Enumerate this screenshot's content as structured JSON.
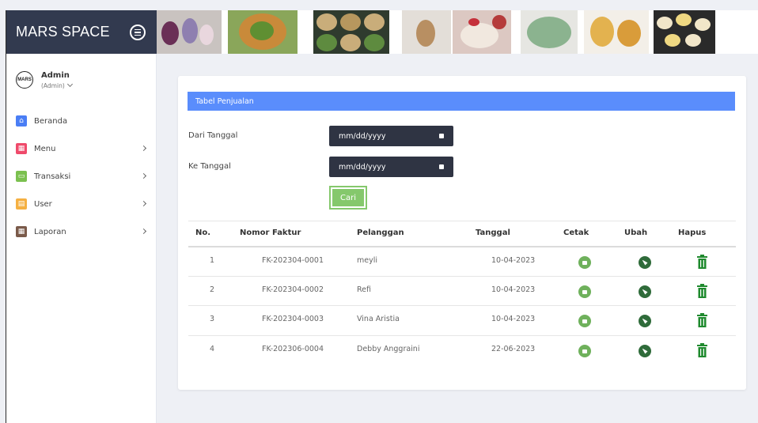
{
  "header": {
    "brand": "MARS SPACE"
  },
  "sidebar": {
    "logo_text": "MARS",
    "user_name": "Admin",
    "user_role": "(Admin)",
    "items": [
      {
        "label": "Beranda",
        "icon": "home-icon",
        "color": "#4a7ef5",
        "has_submenu": false
      },
      {
        "label": "Menu",
        "icon": "grid-icon",
        "color": "#ef4a6b",
        "has_submenu": true
      },
      {
        "label": "Transaksi",
        "icon": "cart-icon",
        "color": "#7bc04f",
        "has_submenu": true
      },
      {
        "label": "User",
        "icon": "user-icon",
        "color": "#f5b042",
        "has_submenu": true
      },
      {
        "label": "Laporan",
        "icon": "report-icon",
        "color": "#7a5a4a",
        "has_submenu": true
      }
    ]
  },
  "card": {
    "title": "Tabel Penjualan",
    "from_label": "Dari Tanggal",
    "to_label": "Ke Tanggal",
    "from_value": "mm/dd/yyyy",
    "to_value": "mm/dd/yyyy",
    "search_button": "Cari"
  },
  "table": {
    "headers": [
      "No.",
      "Nomor Faktur",
      "Pelanggan",
      "Tanggal",
      "Cetak",
      "Ubah",
      "Hapus"
    ],
    "rows": [
      {
        "no": "1",
        "faktur": "FK-202304-0001",
        "pelanggan": "meyli",
        "tanggal": "10-04-2023"
      },
      {
        "no": "2",
        "faktur": "FK-202304-0002",
        "pelanggan": "Refi",
        "tanggal": "10-04-2023"
      },
      {
        "no": "3",
        "faktur": "FK-202304-0003",
        "pelanggan": "Vina Aristia",
        "tanggal": "10-04-2023"
      },
      {
        "no": "4",
        "faktur": "FK-202306-0004",
        "pelanggan": "Debby Anggraini",
        "tanggal": "22-06-2023"
      }
    ]
  },
  "colors": {
    "header_bg": "#323a4f",
    "card_header": "#5a8dfc",
    "button_green": "#85c86c",
    "print_green": "#6fb15c",
    "edit_dark_green": "#2f6b3a",
    "trash_green": "#1f8a2e"
  }
}
